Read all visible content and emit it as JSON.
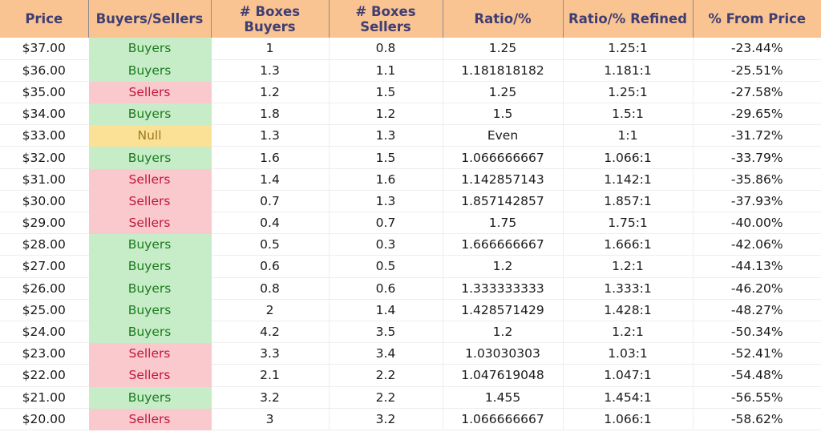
{
  "table": {
    "name": "price-level-order-flow-table",
    "columns": [
      {
        "key": "price",
        "label": "Price"
      },
      {
        "key": "side",
        "label": "Buyers/Sellers"
      },
      {
        "key": "boxes_buy",
        "label": "# Boxes Buyers"
      },
      {
        "key": "boxes_sell",
        "label": "# Boxes Sellers"
      },
      {
        "key": "ratio",
        "label": "Ratio/%"
      },
      {
        "key": "ratio_ref",
        "label": "Ratio/% Refined"
      },
      {
        "key": "from_price",
        "label": "% From Price"
      }
    ],
    "rows": [
      {
        "price": "$37.00",
        "side": "Buyers",
        "side_state": "buyers",
        "boxes_buy": "1",
        "boxes_sell": "0.8",
        "ratio": "1.25",
        "ratio_ref": "1.25:1",
        "from_price": "-23.44%"
      },
      {
        "price": "$36.00",
        "side": "Buyers",
        "side_state": "buyers",
        "boxes_buy": "1.3",
        "boxes_sell": "1.1",
        "ratio": "1.181818182",
        "ratio_ref": "1.181:1",
        "from_price": "-25.51%"
      },
      {
        "price": "$35.00",
        "side": "Sellers",
        "side_state": "sellers",
        "boxes_buy": "1.2",
        "boxes_sell": "1.5",
        "ratio": "1.25",
        "ratio_ref": "1.25:1",
        "from_price": "-27.58%"
      },
      {
        "price": "$34.00",
        "side": "Buyers",
        "side_state": "buyers",
        "boxes_buy": "1.8",
        "boxes_sell": "1.2",
        "ratio": "1.5",
        "ratio_ref": "1.5:1",
        "from_price": "-29.65%"
      },
      {
        "price": "$33.00",
        "side": "Null",
        "side_state": "null",
        "boxes_buy": "1.3",
        "boxes_sell": "1.3",
        "ratio": "Even",
        "ratio_ref": "1:1",
        "from_price": "-31.72%"
      },
      {
        "price": "$32.00",
        "side": "Buyers",
        "side_state": "buyers",
        "boxes_buy": "1.6",
        "boxes_sell": "1.5",
        "ratio": "1.066666667",
        "ratio_ref": "1.066:1",
        "from_price": "-33.79%"
      },
      {
        "price": "$31.00",
        "side": "Sellers",
        "side_state": "sellers",
        "boxes_buy": "1.4",
        "boxes_sell": "1.6",
        "ratio": "1.142857143",
        "ratio_ref": "1.142:1",
        "from_price": "-35.86%"
      },
      {
        "price": "$30.00",
        "side": "Sellers",
        "side_state": "sellers",
        "boxes_buy": "0.7",
        "boxes_sell": "1.3",
        "ratio": "1.857142857",
        "ratio_ref": "1.857:1",
        "from_price": "-37.93%"
      },
      {
        "price": "$29.00",
        "side": "Sellers",
        "side_state": "sellers",
        "boxes_buy": "0.4",
        "boxes_sell": "0.7",
        "ratio": "1.75",
        "ratio_ref": "1.75:1",
        "from_price": "-40.00%"
      },
      {
        "price": "$28.00",
        "side": "Buyers",
        "side_state": "buyers",
        "boxes_buy": "0.5",
        "boxes_sell": "0.3",
        "ratio": "1.666666667",
        "ratio_ref": "1.666:1",
        "from_price": "-42.06%"
      },
      {
        "price": "$27.00",
        "side": "Buyers",
        "side_state": "buyers",
        "boxes_buy": "0.6",
        "boxes_sell": "0.5",
        "ratio": "1.2",
        "ratio_ref": "1.2:1",
        "from_price": "-44.13%"
      },
      {
        "price": "$26.00",
        "side": "Buyers",
        "side_state": "buyers",
        "boxes_buy": "0.8",
        "boxes_sell": "0.6",
        "ratio": "1.333333333",
        "ratio_ref": "1.333:1",
        "from_price": "-46.20%"
      },
      {
        "price": "$25.00",
        "side": "Buyers",
        "side_state": "buyers",
        "boxes_buy": "2",
        "boxes_sell": "1.4",
        "ratio": "1.428571429",
        "ratio_ref": "1.428:1",
        "from_price": "-48.27%"
      },
      {
        "price": "$24.00",
        "side": "Buyers",
        "side_state": "buyers",
        "boxes_buy": "4.2",
        "boxes_sell": "3.5",
        "ratio": "1.2",
        "ratio_ref": "1.2:1",
        "from_price": "-50.34%"
      },
      {
        "price": "$23.00",
        "side": "Sellers",
        "side_state": "sellers",
        "boxes_buy": "3.3",
        "boxes_sell": "3.4",
        "ratio": "1.03030303",
        "ratio_ref": "1.03:1",
        "from_price": "-52.41%"
      },
      {
        "price": "$22.00",
        "side": "Sellers",
        "side_state": "sellers",
        "boxes_buy": "2.1",
        "boxes_sell": "2.2",
        "ratio": "1.047619048",
        "ratio_ref": "1.047:1",
        "from_price": "-54.48%"
      },
      {
        "price": "$21.00",
        "side": "Buyers",
        "side_state": "buyers",
        "boxes_buy": "3.2",
        "boxes_sell": "2.2",
        "ratio": "1.455",
        "ratio_ref": "1.454:1",
        "from_price": "-56.55%"
      },
      {
        "price": "$20.00",
        "side": "Sellers",
        "side_state": "sellers",
        "boxes_buy": "3",
        "boxes_sell": "3.2",
        "ratio": "1.066666667",
        "ratio_ref": "1.066:1",
        "from_price": "-58.62%"
      }
    ]
  },
  "colors": {
    "header_background": "#f9c491",
    "header_text": "#3f3d73",
    "buyers_background": "#c6edc8",
    "buyers_text": "#1d7a1d",
    "sellers_background": "#fac9ce",
    "sellers_text": "#c3173a",
    "null_background": "#fae196",
    "null_text": "#9a7a1c",
    "grid_line": "#eeeeee",
    "header_divider": "#8d8a96",
    "body_text": "#1a1a1a"
  }
}
